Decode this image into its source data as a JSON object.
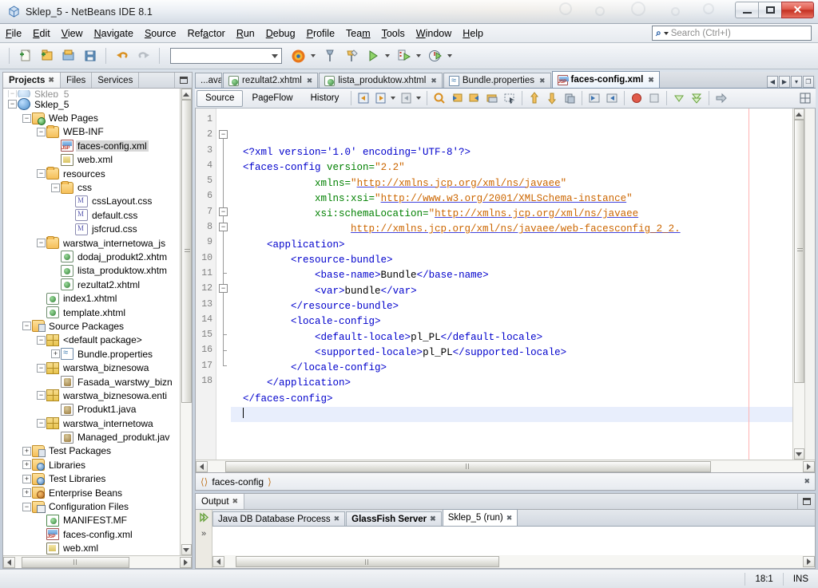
{
  "window": {
    "title": "Sklep_5 - NetBeans IDE 8.1",
    "app_icon": "netbeans-cube-icon",
    "minimize_label": "Minimize",
    "maximize_label": "Maximize",
    "close_label": "Close"
  },
  "menubar": {
    "items": [
      {
        "label": "File",
        "mnemonic": "F"
      },
      {
        "label": "Edit",
        "mnemonic": "E"
      },
      {
        "label": "View",
        "mnemonic": "V"
      },
      {
        "label": "Navigate",
        "mnemonic": "N"
      },
      {
        "label": "Source",
        "mnemonic": "S"
      },
      {
        "label": "Refactor",
        "mnemonic": "a"
      },
      {
        "label": "Run",
        "mnemonic": "R"
      },
      {
        "label": "Debug",
        "mnemonic": "D"
      },
      {
        "label": "Profile",
        "mnemonic": "P"
      },
      {
        "label": "Team",
        "mnemonic": "m"
      },
      {
        "label": "Tools",
        "mnemonic": "T"
      },
      {
        "label": "Window",
        "mnemonic": "W"
      },
      {
        "label": "Help",
        "mnemonic": "H"
      }
    ]
  },
  "search": {
    "placeholder": "Search (Ctrl+I)",
    "value": "",
    "icon": "search-icon"
  },
  "toolbar": {
    "buttons": [
      {
        "name": "new-file-button",
        "icon": "new-file-icon"
      },
      {
        "name": "new-project-button",
        "icon": "new-project-icon"
      },
      {
        "name": "open-project-button",
        "icon": "open-project-icon"
      },
      {
        "name": "save-all-button",
        "icon": "save-all-icon"
      },
      {
        "name": "undo-button",
        "icon": "undo-icon"
      },
      {
        "name": "redo-button",
        "icon": "redo-icon"
      }
    ],
    "config_combo_value": "",
    "browser_button": "firefox-icon",
    "build_button": "build-project-icon",
    "clean_build_button": "clean-build-icon",
    "run_button": "run-project-icon",
    "debug_button": "debug-project-icon",
    "profile_button": "profile-project-icon"
  },
  "left_panel": {
    "tabs": [
      {
        "label": "Projects",
        "active": true,
        "closable": true
      },
      {
        "label": "Files",
        "active": false,
        "closable": false
      },
      {
        "label": "Services",
        "active": false,
        "closable": false
      }
    ],
    "minimize_label": "Minimize Window",
    "tree": [
      {
        "label": "Sklep_5",
        "indent": 0,
        "icon": "project-globe-icon",
        "expander": "minus",
        "clipped_above": true
      },
      {
        "label": "Sklep_5",
        "indent": 0,
        "icon": "project-globe-icon",
        "expander": "minus"
      },
      {
        "label": "Web Pages",
        "indent": 1,
        "icon": "web-pages-folder-icon",
        "expander": "minus"
      },
      {
        "label": "WEB-INF",
        "indent": 2,
        "icon": "folder-icon",
        "expander": "minus"
      },
      {
        "label": "faces-config.xml",
        "indent": 3,
        "icon": "jsf-config-icon",
        "expander": "none",
        "selected": true
      },
      {
        "label": "web.xml",
        "indent": 3,
        "icon": "web-xml-icon",
        "expander": "none"
      },
      {
        "label": "resources",
        "indent": 2,
        "icon": "folder-icon",
        "expander": "minus"
      },
      {
        "label": "css",
        "indent": 3,
        "icon": "folder-icon",
        "expander": "minus"
      },
      {
        "label": "cssLayout.css",
        "indent": 4,
        "icon": "css-file-icon",
        "expander": "none"
      },
      {
        "label": "default.css",
        "indent": 4,
        "icon": "css-file-icon",
        "expander": "none"
      },
      {
        "label": "jsfcrud.css",
        "indent": 4,
        "icon": "css-file-icon",
        "expander": "none"
      },
      {
        "label": "warstwa_internetowa_js",
        "indent": 2,
        "icon": "folder-icon",
        "expander": "minus"
      },
      {
        "label": "dodaj_produkt2.xhtm",
        "indent": 3,
        "icon": "xhtml-file-icon",
        "expander": "none"
      },
      {
        "label": "lista_produktow.xhtm",
        "indent": 3,
        "icon": "xhtml-file-icon",
        "expander": "none"
      },
      {
        "label": "rezultat2.xhtml",
        "indent": 3,
        "icon": "xhtml-file-icon",
        "expander": "none"
      },
      {
        "label": "index1.xhtml",
        "indent": 2,
        "icon": "xhtml-file-icon",
        "expander": "none"
      },
      {
        "label": "template.xhtml",
        "indent": 2,
        "icon": "xhtml-file-icon",
        "expander": "none"
      },
      {
        "label": "Source Packages",
        "indent": 1,
        "icon": "source-packages-icon",
        "expander": "minus"
      },
      {
        "label": "<default package>",
        "indent": 2,
        "icon": "package-icon",
        "expander": "minus"
      },
      {
        "label": "Bundle.properties",
        "indent": 3,
        "icon": "properties-file-icon",
        "expander": "plus"
      },
      {
        "label": "warstwa_biznesowa",
        "indent": 2,
        "icon": "package-icon",
        "expander": "minus"
      },
      {
        "label": "Fasada_warstwy_bizn",
        "indent": 3,
        "icon": "java-file-icon",
        "expander": "none"
      },
      {
        "label": "warstwa_biznesowa.enti",
        "indent": 2,
        "icon": "package-icon",
        "expander": "minus"
      },
      {
        "label": "Produkt1.java",
        "indent": 3,
        "icon": "java-file-icon",
        "expander": "none"
      },
      {
        "label": "warstwa_internetowa",
        "indent": 2,
        "icon": "package-icon",
        "expander": "minus"
      },
      {
        "label": "Managed_produkt.jav",
        "indent": 3,
        "icon": "java-file-icon",
        "expander": "none"
      },
      {
        "label": "Test Packages",
        "indent": 1,
        "icon": "test-packages-icon",
        "expander": "plus"
      },
      {
        "label": "Libraries",
        "indent": 1,
        "icon": "libraries-icon",
        "expander": "plus"
      },
      {
        "label": "Test Libraries",
        "indent": 1,
        "icon": "libraries-icon",
        "expander": "plus"
      },
      {
        "label": "Enterprise Beans",
        "indent": 1,
        "icon": "enterprise-beans-icon",
        "expander": "plus"
      },
      {
        "label": "Configuration Files",
        "indent": 1,
        "icon": "configuration-files-icon",
        "expander": "minus"
      },
      {
        "label": "MANIFEST.MF",
        "indent": 2,
        "icon": "manifest-file-icon",
        "expander": "none"
      },
      {
        "label": "faces-config.xml",
        "indent": 2,
        "icon": "jsf-config-icon",
        "expander": "none"
      },
      {
        "label": "web.xml",
        "indent": 2,
        "icon": "web-xml-icon",
        "expander": "none"
      }
    ]
  },
  "editor": {
    "document_tabs": [
      {
        "label": "...ava",
        "icon": "java-file-icon",
        "active": false,
        "clipped": true,
        "closable": false
      },
      {
        "label": "rezultat2.xhtml",
        "icon": "xhtml-file-icon",
        "active": false,
        "closable": true
      },
      {
        "label": "lista_produktow.xhtml",
        "icon": "xhtml-file-icon",
        "active": false,
        "closable": true
      },
      {
        "label": "Bundle.properties",
        "icon": "properties-file-icon",
        "active": false,
        "closable": true
      },
      {
        "label": "faces-config.xml",
        "icon": "jsf-config-icon",
        "active": true,
        "closable": true
      }
    ],
    "tab_controls": [
      "scroll-left-icon",
      "scroll-right-icon",
      "tab-list-icon",
      "maximize-icon"
    ],
    "view_tabs": [
      {
        "label": "Source",
        "active": true
      },
      {
        "label": "PageFlow",
        "active": false
      },
      {
        "label": "History",
        "active": false
      }
    ],
    "toolbar_icons": [
      "last-edit-icon",
      "back-navigation-icon",
      "forward-navigation-icon",
      "find-selection-icon",
      "previous-occurrence-icon",
      "next-occurrence-icon",
      "toggle-highlight-icon",
      "rectangular-selection-icon",
      "shift-line-left-icon",
      "shift-line-right-icon",
      "start-macro-recording-icon",
      "comment-icon",
      "uncomment-icon",
      "stop-macro-icon",
      "stop-icon",
      "collapse-fold-icon",
      "collapse-all-folds-icon",
      "inspect-icon",
      "maximize-editor-icon"
    ],
    "filename": "faces-config.xml",
    "lines": [
      {
        "n": 1,
        "fold": "none",
        "tokens": [
          {
            "t": "tx",
            "s": "  "
          },
          {
            "t": "tg",
            "s": "<?xml version='1.0' encoding='UTF-8'?>"
          }
        ]
      },
      {
        "n": 2,
        "fold": "box",
        "tokens": [
          {
            "t": "tx",
            "s": "  "
          },
          {
            "t": "tg",
            "s": "<faces-config "
          },
          {
            "t": "at",
            "s": "version="
          },
          {
            "t": "vl",
            "s": "\"2.2\""
          }
        ]
      },
      {
        "n": 3,
        "fold": "line",
        "tokens": [
          {
            "t": "tx",
            "s": "              "
          },
          {
            "t": "at",
            "s": "xmlns="
          },
          {
            "t": "vl",
            "s": "\""
          },
          {
            "t": "lnk",
            "s": "http://xmlns.jcp.org/xml/ns/javaee"
          },
          {
            "t": "vl",
            "s": "\""
          }
        ]
      },
      {
        "n": 4,
        "fold": "line",
        "tokens": [
          {
            "t": "tx",
            "s": "              "
          },
          {
            "t": "at",
            "s": "xmlns:xsi="
          },
          {
            "t": "vl",
            "s": "\""
          },
          {
            "t": "lnk",
            "s": "http://www.w3.org/2001/XMLSchema-instance"
          },
          {
            "t": "vl",
            "s": "\""
          }
        ]
      },
      {
        "n": 5,
        "fold": "line",
        "tokens": [
          {
            "t": "tx",
            "s": "              "
          },
          {
            "t": "at",
            "s": "xsi:schemaLocation="
          },
          {
            "t": "vl",
            "s": "\""
          },
          {
            "t": "lnk",
            "s": "http://xmlns.jcp.org/xml/ns/javaee"
          }
        ]
      },
      {
        "n": 6,
        "fold": "line",
        "tokens": [
          {
            "t": "tx",
            "s": "                    "
          },
          {
            "t": "lnk",
            "s": "http://xmlns.jcp.org/xml/ns/javaee/web-facesconfig_2_2."
          }
        ]
      },
      {
        "n": 7,
        "fold": "box",
        "tokens": [
          {
            "t": "tx",
            "s": "      "
          },
          {
            "t": "tg",
            "s": "<application>"
          }
        ]
      },
      {
        "n": 8,
        "fold": "box",
        "tokens": [
          {
            "t": "tx",
            "s": "          "
          },
          {
            "t": "tg",
            "s": "<resource-bundle>"
          }
        ]
      },
      {
        "n": 9,
        "fold": "line",
        "tokens": [
          {
            "t": "tx",
            "s": "              "
          },
          {
            "t": "tg",
            "s": "<base-name>"
          },
          {
            "t": "tx",
            "s": "Bundle"
          },
          {
            "t": "tg",
            "s": "</base-name>"
          }
        ]
      },
      {
        "n": 10,
        "fold": "line",
        "tokens": [
          {
            "t": "tx",
            "s": "              "
          },
          {
            "t": "tg",
            "s": "<var>"
          },
          {
            "t": "tx",
            "s": "bundle"
          },
          {
            "t": "tg",
            "s": "</var>"
          }
        ]
      },
      {
        "n": 11,
        "fold": "tick",
        "tokens": [
          {
            "t": "tx",
            "s": "          "
          },
          {
            "t": "tg",
            "s": "</resource-bundle>"
          }
        ]
      },
      {
        "n": 12,
        "fold": "box",
        "tokens": [
          {
            "t": "tx",
            "s": "          "
          },
          {
            "t": "tg",
            "s": "<locale-config>"
          }
        ]
      },
      {
        "n": 13,
        "fold": "line",
        "tokens": [
          {
            "t": "tx",
            "s": "              "
          },
          {
            "t": "tg",
            "s": "<default-locale>"
          },
          {
            "t": "tx",
            "s": "pl_PL"
          },
          {
            "t": "tg",
            "s": "</default-locale>"
          }
        ]
      },
      {
        "n": 14,
        "fold": "line",
        "tokens": [
          {
            "t": "tx",
            "s": "              "
          },
          {
            "t": "tg",
            "s": "<supported-locale>"
          },
          {
            "t": "tx",
            "s": "pl_PL"
          },
          {
            "t": "tg",
            "s": "</supported-locale>"
          }
        ]
      },
      {
        "n": 15,
        "fold": "tick",
        "tokens": [
          {
            "t": "tx",
            "s": "          "
          },
          {
            "t": "tg",
            "s": "</locale-config>"
          }
        ]
      },
      {
        "n": 16,
        "fold": "tick",
        "tokens": [
          {
            "t": "tx",
            "s": "      "
          },
          {
            "t": "tg",
            "s": "</application>"
          }
        ]
      },
      {
        "n": 17,
        "fold": "end",
        "tokens": [
          {
            "t": "tx",
            "s": "  "
          },
          {
            "t": "tg",
            "s": "</faces-config>"
          }
        ]
      },
      {
        "n": 18,
        "fold": "none",
        "tokens": [
          {
            "t": "tx",
            "s": "  "
          }
        ],
        "current": true
      }
    ]
  },
  "navigator_strip": {
    "label": "faces-config",
    "icon": "xml-breadcrumb-icon",
    "close_label": "Close"
  },
  "output": {
    "window_title": "Output",
    "minimize_label": "Minimize Window",
    "side_icons": [
      "rerun-icon",
      "expand-icon"
    ],
    "tabs": [
      {
        "label": "Java DB Database Process",
        "active": false,
        "bold": false,
        "closable": true
      },
      {
        "label": "GlassFish Server",
        "active": false,
        "bold": true,
        "closable": true
      },
      {
        "label": "Sklep_5 (run)",
        "active": true,
        "bold": false,
        "closable": true
      }
    ],
    "content": ""
  },
  "statusbar": {
    "message": "",
    "cursor_position": "18:1",
    "insert_mode": "INS"
  },
  "colors": {
    "tag": "#0000cc",
    "attribute": "#008000",
    "value": "#cc6600",
    "selection": "#e8eefc",
    "tree_selection": "#d8d8d8",
    "close_button": "#c33122",
    "right_margin": "#ffb3b3"
  }
}
